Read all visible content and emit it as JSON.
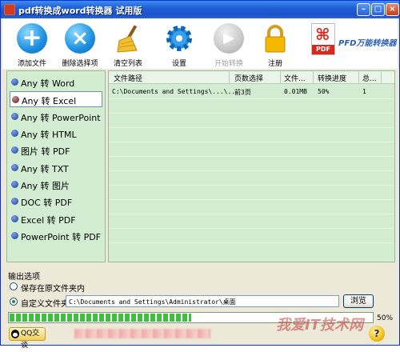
{
  "window": {
    "title": "pdf转换成word转换器 试用版"
  },
  "toolbar": {
    "items": [
      {
        "label": "添加文件",
        "icon": "plus-icon"
      },
      {
        "label": "删除选择项",
        "icon": "x-icon"
      },
      {
        "label": "清空列表",
        "icon": "broom-icon"
      },
      {
        "label": "设置",
        "icon": "gear-icon"
      },
      {
        "label": "开始转换",
        "icon": "play-icon"
      },
      {
        "label": "注册",
        "icon": "lock-icon"
      }
    ],
    "brand_text": "PFD万能转换器",
    "brand_doc_label": "PDF"
  },
  "categories": [
    {
      "label": "Any 转 Word",
      "selected": false
    },
    {
      "label": "Any 转 Excel",
      "selected": true
    },
    {
      "label": "Any 转 PowerPoint",
      "selected": false
    },
    {
      "label": "Any 转 HTML",
      "selected": false
    },
    {
      "label": "图片 转 PDF",
      "selected": false
    },
    {
      "label": "Any 转 TXT",
      "selected": false
    },
    {
      "label": "Any 转 图片",
      "selected": false
    },
    {
      "label": "DOC 转 PDF",
      "selected": false
    },
    {
      "label": "Excel 转 PDF",
      "selected": false
    },
    {
      "label": "PowerPoint 转 PDF",
      "selected": false
    }
  ],
  "table": {
    "columns": [
      "文件路径",
      "页数选择",
      "文件...",
      "转换进度",
      "总..."
    ],
    "rows": [
      [
        "C:\\Documents and Settings\\...\\...",
        "前3页",
        "0.01MB",
        "50%",
        "1"
      ]
    ]
  },
  "output": {
    "title": "输出选项",
    "option_original": "保存在原文件夹内",
    "option_custom": "自定义文件夹",
    "selected_option": "custom",
    "path_value": "C:\\Documents and Settings\\Administrator\\桌面",
    "browse_label": "浏览"
  },
  "progress": {
    "value": 0.5,
    "label": "50%"
  },
  "footer": {
    "qq_label": "QQ交谈",
    "watermark": "我爱IT技术网",
    "help_glyph": "?"
  },
  "colors": {
    "panel_bg": "#d3edd3",
    "title_bar": "#1f5fd6",
    "progress_fill": "#3fbf3f",
    "brand_text": "#2c5fb0"
  }
}
